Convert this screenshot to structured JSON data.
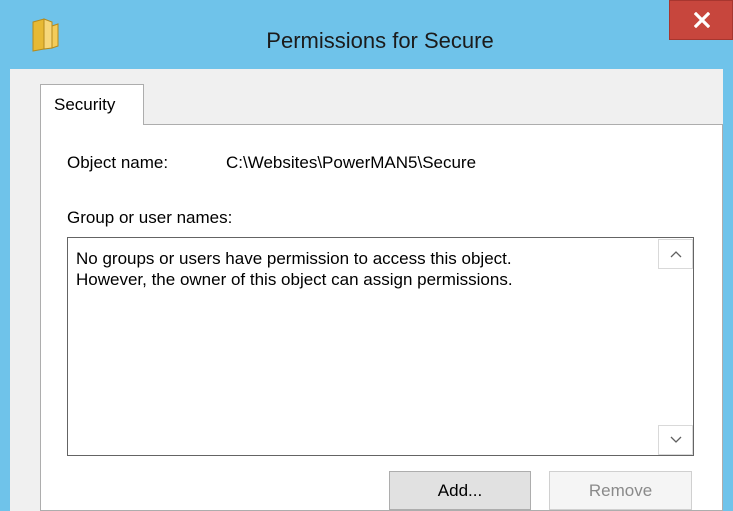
{
  "window": {
    "title": "Permissions for Secure",
    "titlebar_color": "#6fc3ea",
    "close_glyph": "x",
    "close_color": "#c7463d"
  },
  "tabs": [
    {
      "label": "Security",
      "selected": true
    }
  ],
  "object": {
    "label": "Object name:",
    "value": "C:\\Websites\\PowerMAN5\\Secure"
  },
  "group_list": {
    "label": "Group or user names:",
    "message_line1": "No groups or users have permission to access this object.",
    "message_line2": "However, the owner of this object can assign permissions."
  },
  "buttons": {
    "add": "Add...",
    "remove": "Remove"
  },
  "icons": {
    "title": "folder-icon",
    "close": "close-icon",
    "scroll_up": "chevron-up-icon",
    "scroll_down": "chevron-down-icon"
  }
}
